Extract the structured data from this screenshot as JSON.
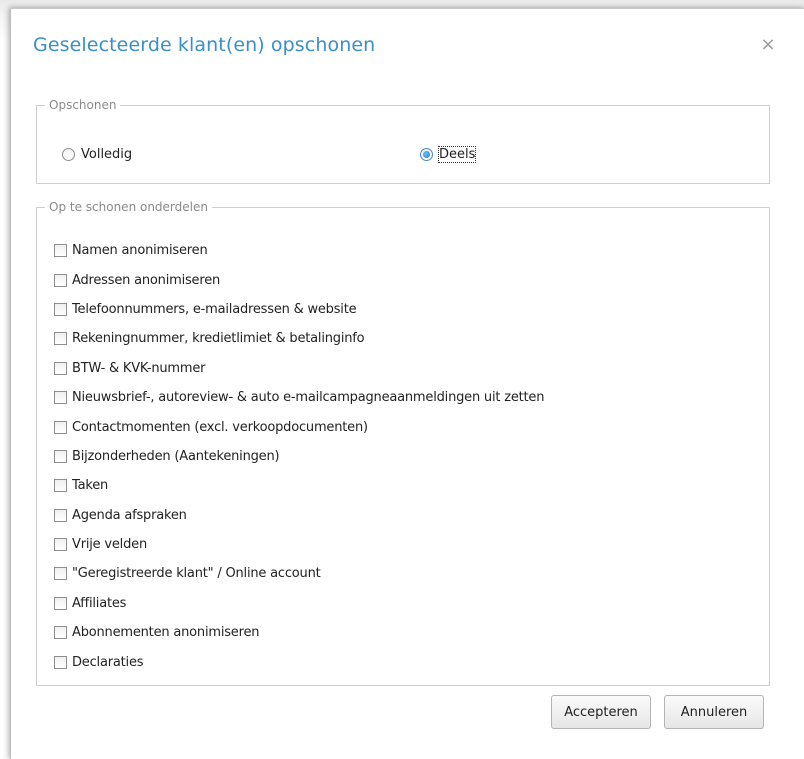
{
  "dialog": {
    "title": "Geselecteerde klant(en) opschonen",
    "close_symbol": "×"
  },
  "opschonen": {
    "legend": "Opschonen",
    "options": [
      {
        "label": "Volledig",
        "checked": false
      },
      {
        "label": "Deels",
        "checked": true
      }
    ]
  },
  "onderdelen": {
    "legend": "Op te schonen onderdelen",
    "items": [
      {
        "label": "Namen anonimiseren",
        "checked": false
      },
      {
        "label": "Adressen anonimiseren",
        "checked": false
      },
      {
        "label": "Telefoonnummers, e-mailadressen & website",
        "checked": false
      },
      {
        "label": "Rekeningnummer, kredietlimiet & betalinginfo",
        "checked": false
      },
      {
        "label": "BTW- & KVK-nummer",
        "checked": false
      },
      {
        "label": "Nieuwsbrief-, autoreview- & auto e-mailcampagneaanmeldingen uit zetten",
        "checked": false
      },
      {
        "label": "Contactmomenten (excl. verkoopdocumenten)",
        "checked": false
      },
      {
        "label": "Bijzonderheden (Aantekeningen)",
        "checked": false
      },
      {
        "label": "Taken",
        "checked": false
      },
      {
        "label": "Agenda afspraken",
        "checked": false
      },
      {
        "label": "Vrije velden",
        "checked": false
      },
      {
        "label": "\"Geregistreerde klant\" / Online account",
        "checked": false
      },
      {
        "label": "Affiliates",
        "checked": false
      },
      {
        "label": "Abonnementen anonimiseren",
        "checked": false
      },
      {
        "label": "Declaraties",
        "checked": false
      }
    ]
  },
  "buttons": {
    "accept_label": "Accepteren",
    "cancel_label": "Annuleren"
  },
  "colors": {
    "title": "#3a8fc7",
    "radio_selected": "#1f78c8"
  }
}
